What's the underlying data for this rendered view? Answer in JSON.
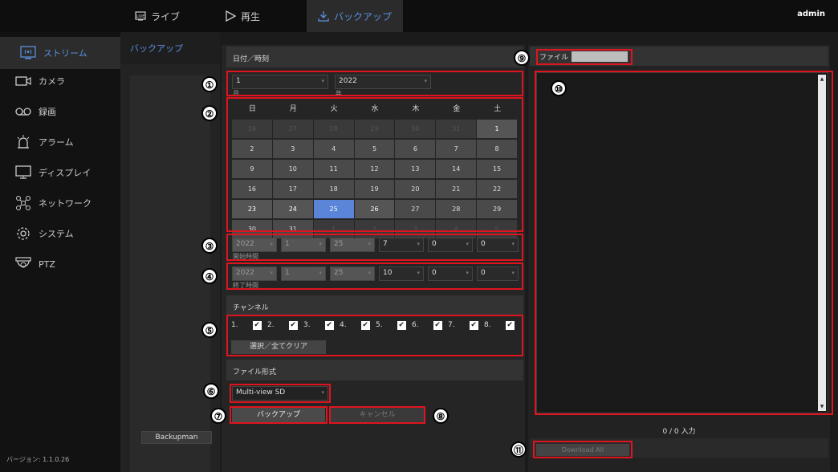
{
  "topbar": {
    "tabs": [
      {
        "label": "ライブ",
        "icon": "live-icon"
      },
      {
        "label": "再生",
        "icon": "play-icon"
      },
      {
        "label": "バックアップ",
        "icon": "download-icon"
      }
    ],
    "user": "admin"
  },
  "sidebar": {
    "items": [
      {
        "label": "ストリーム",
        "icon": "stream-icon"
      },
      {
        "label": "カメラ",
        "icon": "camera-icon"
      },
      {
        "label": "録画",
        "icon": "record-icon"
      },
      {
        "label": "アラーム",
        "icon": "alarm-icon"
      },
      {
        "label": "ディスプレイ",
        "icon": "display-icon"
      },
      {
        "label": "ネットワーク",
        "icon": "network-icon"
      },
      {
        "label": "システム",
        "icon": "system-gear-icon"
      },
      {
        "label": "PTZ",
        "icon": "ptz-icon"
      }
    ],
    "version": "バージョン: 1.1.0.26"
  },
  "subpanel": {
    "title": "バックアップ",
    "backupman": "Backupman"
  },
  "date": {
    "header": "日付／時刻",
    "month_value": "1",
    "month_label": "月",
    "year_value": "2022",
    "year_label": "年",
    "weekdays": [
      "日",
      "月",
      "火",
      "水",
      "木",
      "金",
      "土"
    ],
    "selected_day": "25"
  },
  "start": {
    "label": "開始時間",
    "year": "2022",
    "month": "1",
    "day": "25",
    "hour": "7",
    "minute": "0",
    "second": "0"
  },
  "end": {
    "label": "終了時間",
    "year": "2022",
    "month": "1",
    "day": "25",
    "hour": "10",
    "minute": "0",
    "second": "0"
  },
  "channels": {
    "header": "チャンネル",
    "items": [
      "1.",
      "2.",
      "3.",
      "4.",
      "5.",
      "6.",
      "7.",
      "8."
    ],
    "clear_label": "選択／全てクリア"
  },
  "format": {
    "header": "ファイル形式",
    "value": "Multi-view SD"
  },
  "actions": {
    "backup": "バックアップ",
    "cancel": "キャンセル"
  },
  "files": {
    "label": "ファイル",
    "count": "0 / 0 入力",
    "download_all": "Download All"
  },
  "callouts": [
    "①",
    "②",
    "③",
    "④",
    "⑤",
    "⑥",
    "⑦",
    "⑧",
    "⑨",
    "⑩",
    "⑪"
  ],
  "colors": {
    "accent": "#5a8fe0",
    "callout_border": "#e0141e",
    "selected_day": "#5b85d8"
  }
}
